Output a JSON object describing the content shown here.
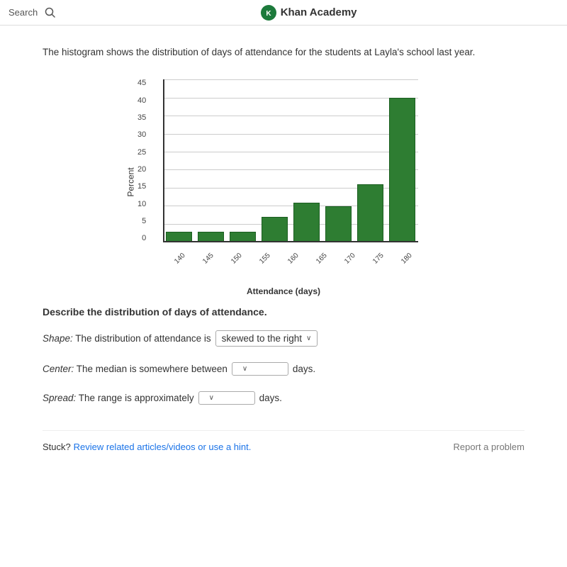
{
  "topbar": {
    "search_label": "Search",
    "brand_name": "Khan Academy",
    "brand_icon_text": "K"
  },
  "problem": {
    "description": "The histogram shows the distribution of days of attendance for the students at Layla's school last year.",
    "chart": {
      "y_label": "Percent",
      "x_label": "Attendance (days)",
      "y_ticks": [
        "45",
        "40",
        "35",
        "30",
        "25",
        "20",
        "15",
        "10",
        "5",
        "0"
      ],
      "x_ticks": [
        "140",
        "145",
        "150",
        "155",
        "160",
        "165",
        "170",
        "175",
        "180"
      ],
      "bars": [
        {
          "label": "140-145",
          "value": 3
        },
        {
          "label": "145-150",
          "value": 3
        },
        {
          "label": "150-155",
          "value": 3
        },
        {
          "label": "155-160",
          "value": 7
        },
        {
          "label": "160-165",
          "value": 11
        },
        {
          "label": "165-170",
          "value": 10
        },
        {
          "label": "170-175",
          "value": 16
        },
        {
          "label": "175-180",
          "value": 40
        }
      ],
      "y_max": 45
    },
    "describe_title": "Describe the distribution of days of attendance.",
    "shape_label": "Shape: The distribution of attendance is",
    "shape_value": "skewed to the right",
    "center_label": "Center: The median is somewhere between",
    "center_unit": "days.",
    "center_value": "",
    "spread_label": "Spread: The range is approximately",
    "spread_unit": "days.",
    "spread_value": ""
  },
  "footer": {
    "stuck_text": "Stuck?",
    "review_text": "Review related articles/videos or use a hint.",
    "report_text": "Report a problem"
  }
}
